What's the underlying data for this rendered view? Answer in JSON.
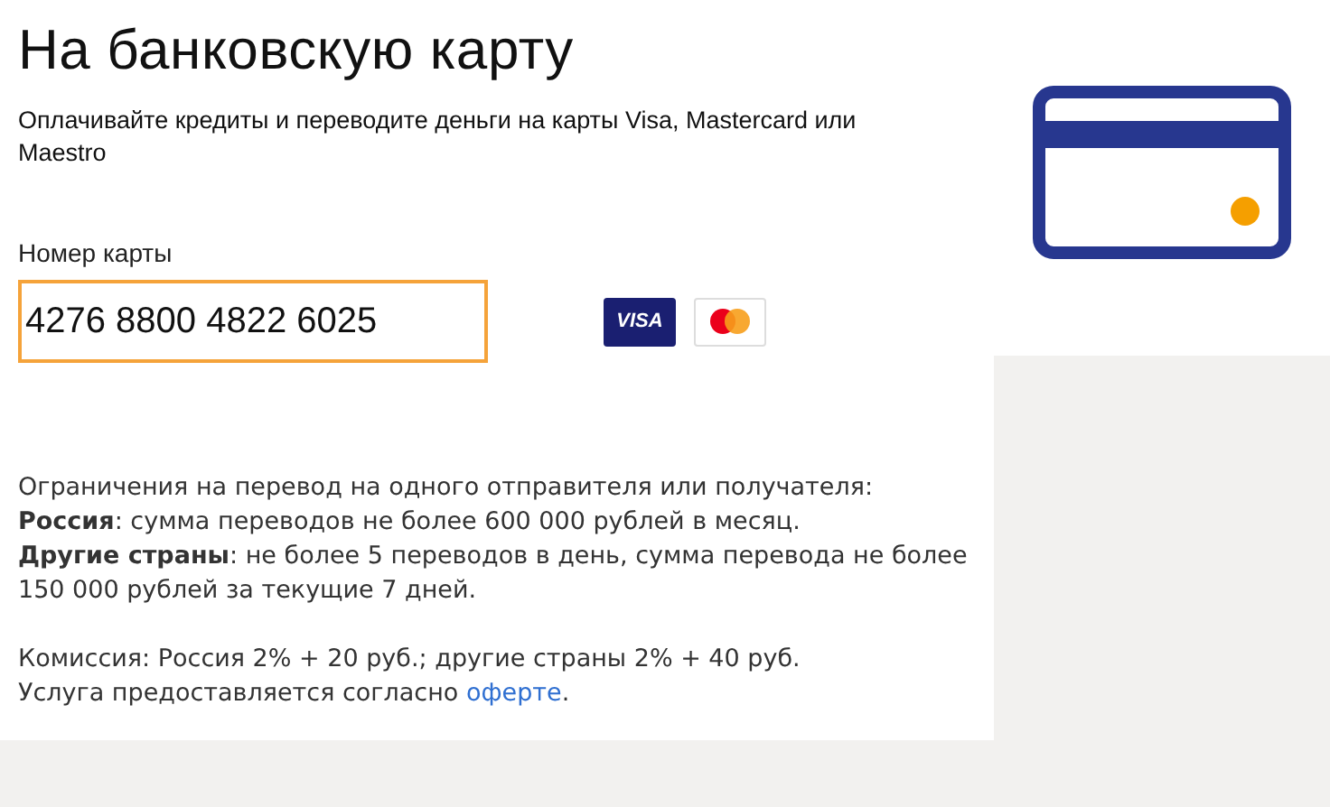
{
  "title": "На банковскую карту",
  "subtitle": "Оплачивайте кредиты и переводите деньги на карты Visa, Mastercard или Maestro",
  "card_field": {
    "label": "Номер карты",
    "value": "4276 8800 4822 6025",
    "focused": true
  },
  "card_logos": [
    {
      "kind": "visa",
      "text": "VISA"
    },
    {
      "kind": "mastercard"
    }
  ],
  "limits": [
    "Ограничения на перевод на одного отправителя или получателя:",
    "**Россия**: сумма переводов не более 600 000 рублей в месяц.",
    "**Другие страны**: не более 5 переводов в день, сумма перевода не более 150 000 рублей за текущие 7 дней."
  ],
  "commission": "Комиссия: Россия 2% + 20 руб.; другие страны 2% + 40 руб.",
  "offer": {
    "text": "Услуга предоставляется согласно",
    "link": "оферте",
    "after": "."
  }
}
